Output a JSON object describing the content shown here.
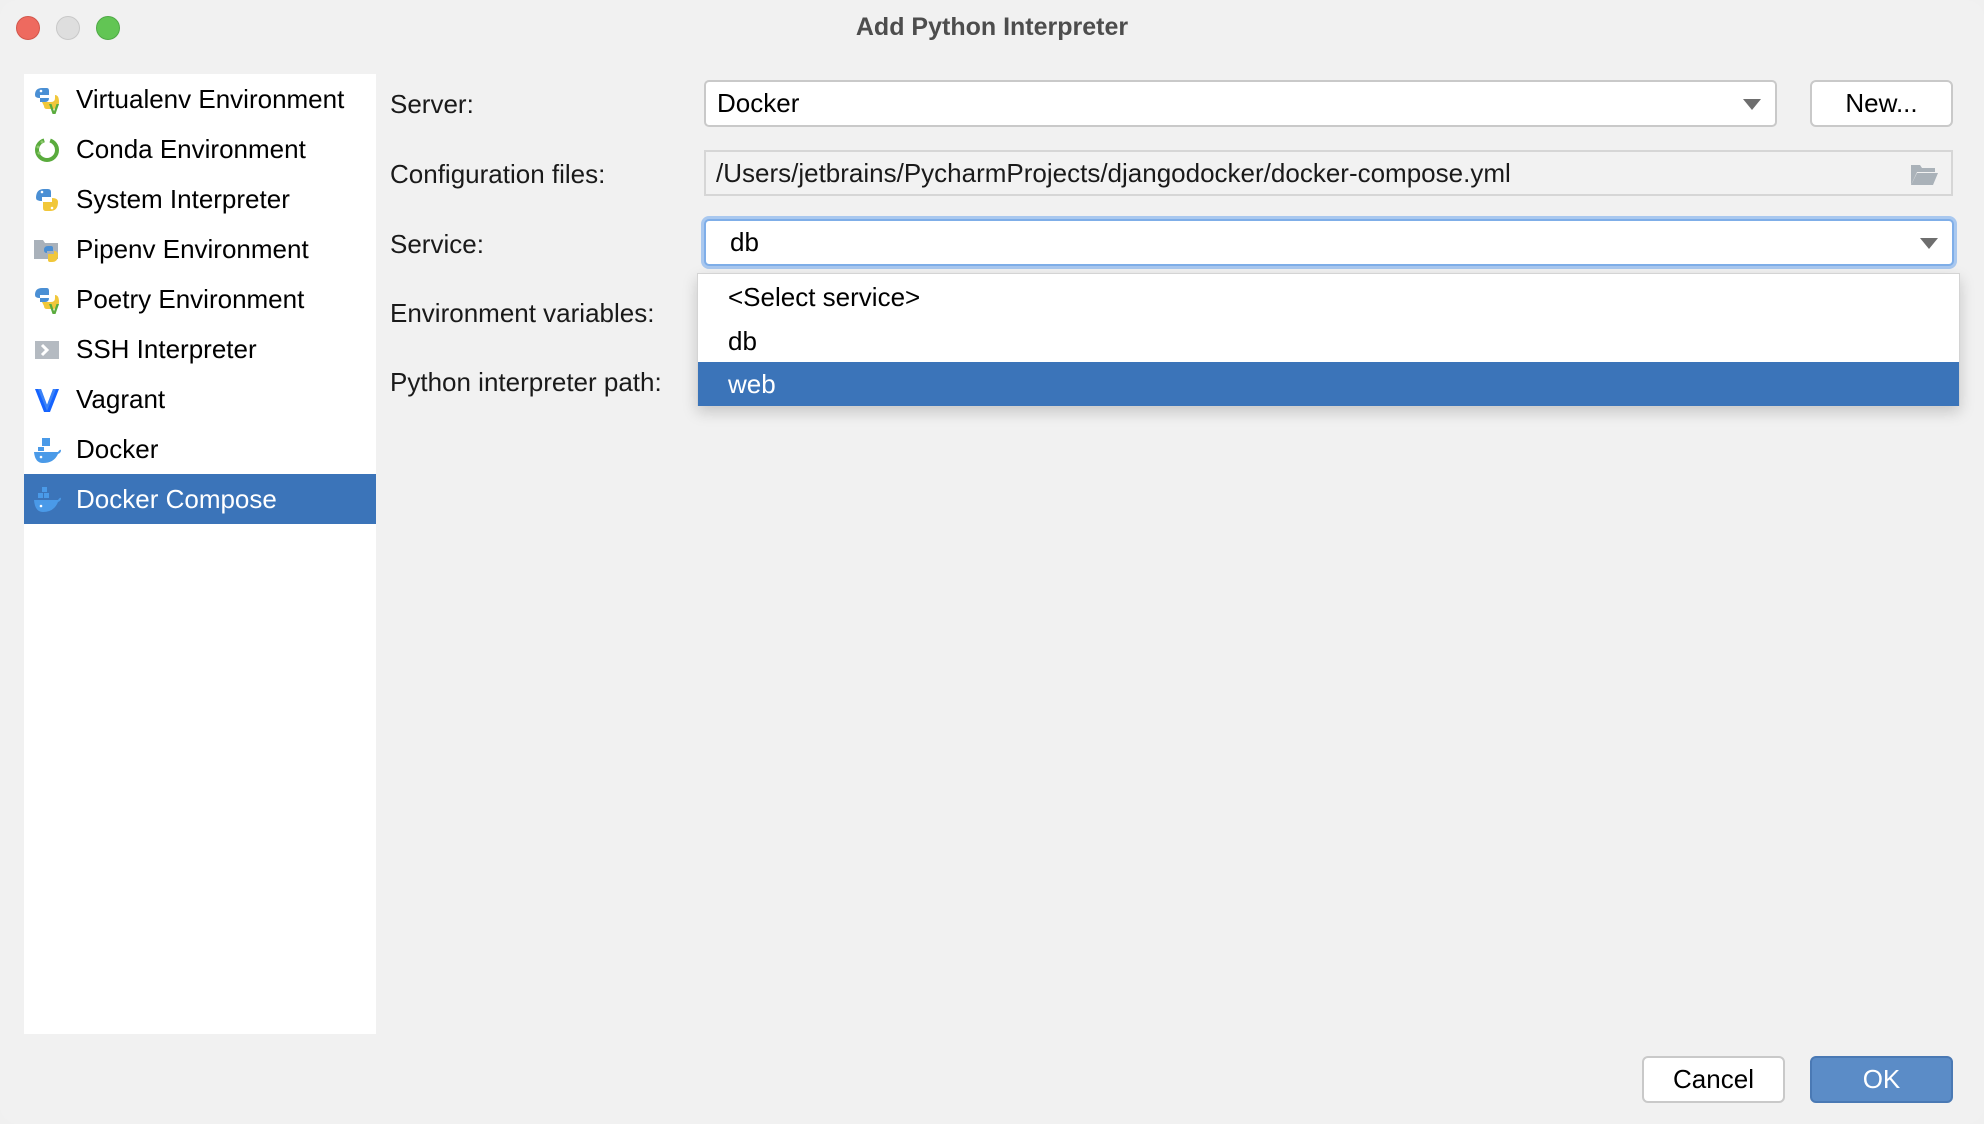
{
  "window": {
    "title": "Add Python Interpreter",
    "controls": [
      "close",
      "minimize",
      "maximize"
    ]
  },
  "sidebar": {
    "items": [
      {
        "label": "Virtualenv Environment",
        "icon": "virtualenv-icon",
        "selected": false
      },
      {
        "label": "Conda Environment",
        "icon": "conda-icon",
        "selected": false
      },
      {
        "label": "System Interpreter",
        "icon": "python-icon",
        "selected": false
      },
      {
        "label": "Pipenv Environment",
        "icon": "pipenv-icon",
        "selected": false
      },
      {
        "label": "Poetry Environment",
        "icon": "poetry-icon",
        "selected": false
      },
      {
        "label": "SSH Interpreter",
        "icon": "ssh-icon",
        "selected": false
      },
      {
        "label": "Vagrant",
        "icon": "vagrant-icon",
        "selected": false
      },
      {
        "label": "Docker",
        "icon": "docker-icon",
        "selected": false
      },
      {
        "label": "Docker Compose",
        "icon": "docker-compose-icon",
        "selected": true
      }
    ]
  },
  "form": {
    "server_label": "Server:",
    "server_value": "Docker",
    "new_button": "New...",
    "config_label": "Configuration files:",
    "config_value": "/Users/jetbrains/PycharmProjects/djangodocker/docker-compose.yml",
    "service_label": "Service:",
    "service_value": "db",
    "env_label": "Environment variables:",
    "interpreter_label": "Python interpreter path:"
  },
  "service_dropdown": {
    "options": [
      "<Select service>",
      "db",
      "web"
    ],
    "highlighted": "web"
  },
  "footer": {
    "cancel": "Cancel",
    "ok": "OK"
  },
  "colors": {
    "selection": "#3b74b9",
    "primary_button": "#5b8cc7",
    "focus_ring": "#a9c8ef"
  }
}
